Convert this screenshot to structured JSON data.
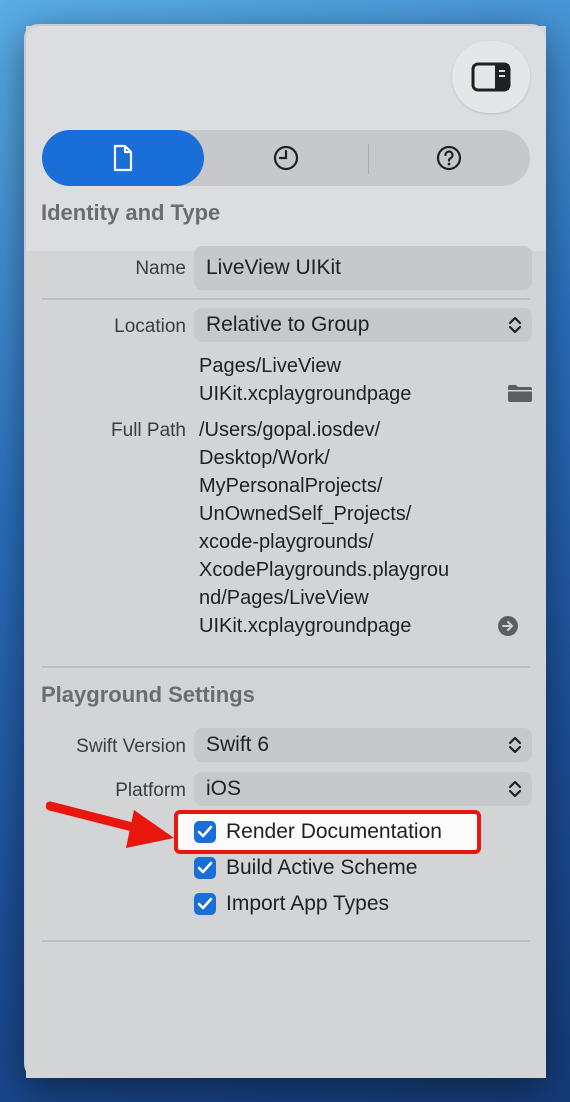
{
  "segments": {
    "file_icon": "document-icon",
    "history_icon": "clock-icon",
    "help_icon": "help-icon"
  },
  "identity": {
    "title": "Identity and Type",
    "name_label": "Name",
    "name_value": "LiveView UIKit",
    "location_label": "Location",
    "location_value": "Relative to Group",
    "relative_path": "Pages/LiveView\nUIKit.xcplaygroundpage",
    "full_path_label": "Full Path",
    "full_path": "/Users/gopal.iosdev/\nDesktop/Work/\nMyPersonalProjects/\nUnOwnedSelf_Projects/\nxcode-playgrounds/\nXcodePlaygrounds.playgrou\nnd/Pages/LiveView\nUIKit.xcplaygroundpage"
  },
  "playground": {
    "title": "Playground Settings",
    "swift_label": "Swift Version",
    "swift_value": "Swift 6",
    "platform_label": "Platform",
    "platform_value": "iOS",
    "checkboxes": [
      {
        "label": "Render Documentation",
        "checked": true
      },
      {
        "label": "Build Active Scheme",
        "checked": true
      },
      {
        "label": "Import App Types",
        "checked": true
      }
    ]
  },
  "colors": {
    "accent": "#1a6ed8",
    "highlight": "#e8160c"
  }
}
